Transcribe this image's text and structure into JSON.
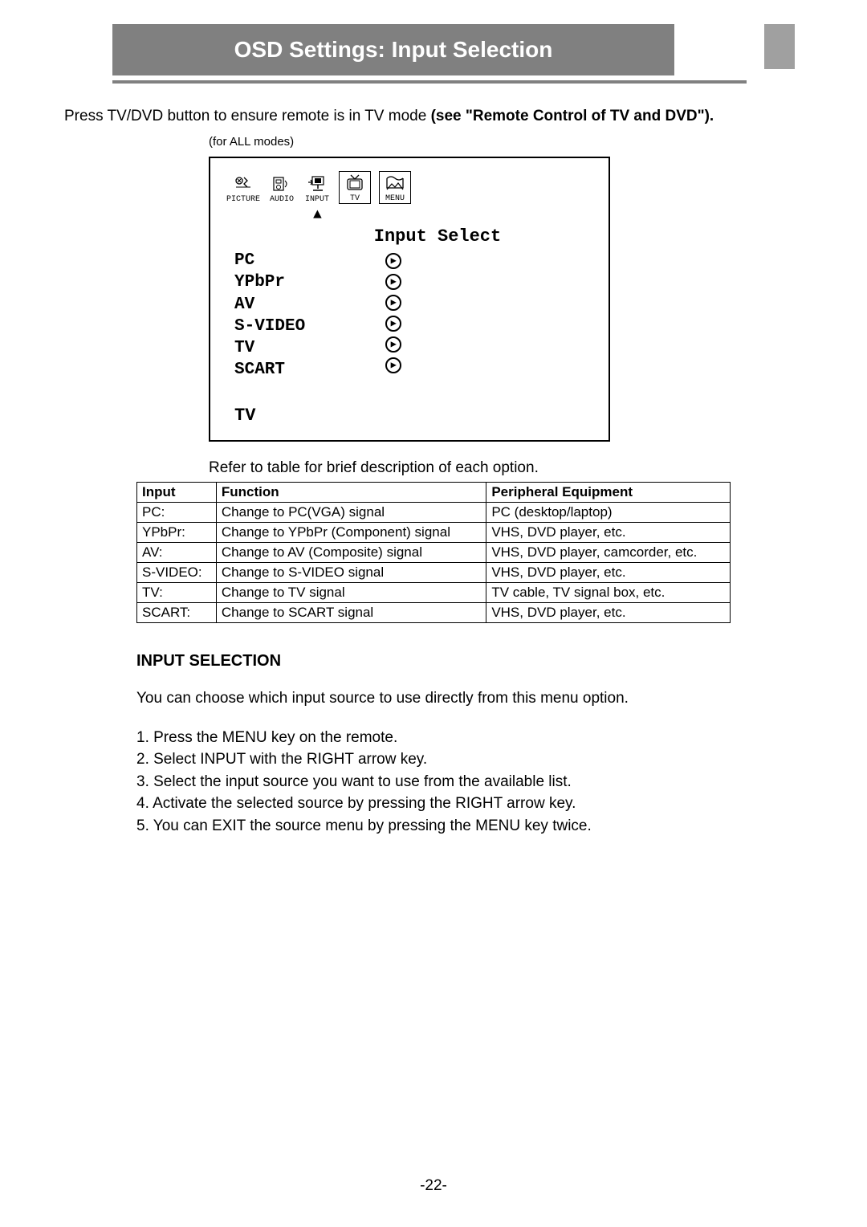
{
  "header": {
    "title": "OSD Settings: Input Selection"
  },
  "intro": {
    "text_prefix": "Press TV/DVD button to ensure remote is in TV mode ",
    "text_bold": "(see \"Remote Control of TV and DVD\").",
    "modes_note": "(for ALL modes)"
  },
  "osd": {
    "tabs": [
      {
        "label": "PICTURE"
      },
      {
        "label": "AUDIO"
      },
      {
        "label": "INPUT"
      },
      {
        "label": "TV"
      },
      {
        "label": "MENU"
      }
    ],
    "title": "Input Select",
    "items": [
      "PC",
      "YPbPr",
      "AV",
      "S-VIDEO",
      "TV",
      "SCART"
    ],
    "footer": "TV"
  },
  "table": {
    "caption": "Refer to table for brief description of each option.",
    "headers": [
      "Input",
      "Function",
      "Peripheral Equipment"
    ],
    "rows": [
      [
        "PC:",
        "Change to PC(VGA) signal",
        "PC (desktop/laptop)"
      ],
      [
        "YPbPr:",
        "Change to YPbPr (Component) signal",
        "VHS, DVD player, etc."
      ],
      [
        "AV:",
        "Change to AV (Composite) signal",
        "VHS, DVD player, camcorder, etc."
      ],
      [
        "S-VIDEO:",
        "Change to S-VIDEO signal",
        "VHS, DVD player, etc."
      ],
      [
        "TV:",
        "Change to TV signal",
        "TV cable, TV signal box, etc."
      ],
      [
        "SCART:",
        "Change to SCART signal",
        "VHS, DVD player, etc."
      ]
    ]
  },
  "section": {
    "heading": "INPUT SELECTION",
    "body": "You can choose which input source to use directly from this menu option.",
    "steps": [
      "1.  Press the MENU key on the remote.",
      "2.  Select INPUT with the RIGHT arrow key.",
      "3.  Select the input source you want to use from the available list.",
      "4.  Activate the selected source by pressing the RIGHT arrow key.",
      "5.  You can EXIT the source menu by pressing the MENU key twice."
    ]
  },
  "page_number": "-22-"
}
